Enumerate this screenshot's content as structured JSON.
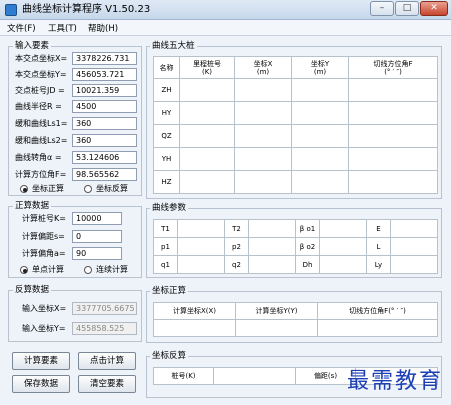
{
  "window": {
    "title": "曲线坐标计算程序 V1.50.23",
    "minimize": "–",
    "maximize": "□",
    "close": "✕"
  },
  "menu": [
    {
      "label": "文件(F)"
    },
    {
      "label": "工具(T)"
    },
    {
      "label": "帮助(H)"
    }
  ],
  "input_elements": {
    "title": "输入要素",
    "fields": [
      {
        "label": "本交点坐标X=",
        "value": "3378226.731"
      },
      {
        "label": "本交点坐标Y=",
        "value": "456053.721"
      },
      {
        "label": "交点桩号JD =",
        "value": "10021.359"
      },
      {
        "label": "曲线半径R  =",
        "value": "4500"
      },
      {
        "label": "缓和曲线Ls1=",
        "value": "360"
      },
      {
        "label": "缓和曲线Ls2=",
        "value": "360"
      },
      {
        "label": "曲线转角α =",
        "value": "53.124606"
      },
      {
        "label": "计算方位角F=",
        "value": "98.565562"
      }
    ],
    "radio_forward": "坐标正算",
    "radio_inverse": "坐标反算"
  },
  "forward_data": {
    "title": "正算数据",
    "fields": [
      {
        "label": "计算桩号K=",
        "value": "10000"
      },
      {
        "label": "计算偏距s=",
        "value": "0"
      },
      {
        "label": "计算偏角a=",
        "value": "90"
      }
    ],
    "radio_single": "单点计算",
    "radio_continuous": "连续计算"
  },
  "inverse_data": {
    "title": "反算数据",
    "fields": [
      {
        "label": "输入坐标X=",
        "value": "3377705.6675"
      },
      {
        "label": "输入坐标Y=",
        "value": "455858.525"
      }
    ]
  },
  "buttons": {
    "calc_elements": "计算要素",
    "click_calc": "点击计算",
    "save_data": "保存数据",
    "clear_elements": "清空要素"
  },
  "five_points": {
    "title": "曲线五大桩",
    "headers": [
      "名称",
      "里程桩号\n(K)",
      "坐标X\n(m)",
      "坐标Y\n(m)",
      "切线方位角F\n(° ′ ″)"
    ],
    "rows": [
      "ZH",
      "HY",
      "QZ",
      "YH",
      "HZ"
    ]
  },
  "curve_params": {
    "title": "曲线参数",
    "rows": [
      [
        "T1",
        "T2",
        "β o1",
        "E"
      ],
      [
        "p1",
        "p2",
        "β o2",
        "L"
      ],
      [
        "q1",
        "q2",
        "Dh",
        "Ly"
      ]
    ]
  },
  "coord_forward": {
    "title": "坐标正算",
    "headers": [
      "计算坐标X(X)",
      "计算坐标Y(Y)",
      "切线方位角F(° ′ ″)"
    ]
  },
  "coord_inverse": {
    "title": "坐标反算",
    "labels": [
      "桩号(K)",
      "偏距(s)"
    ]
  },
  "watermark": "最需教育"
}
